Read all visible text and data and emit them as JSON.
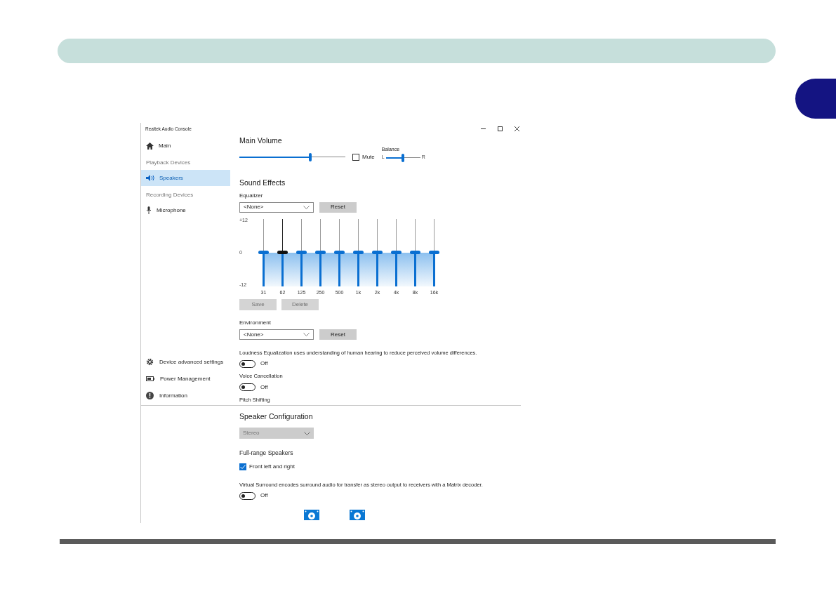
{
  "window": {
    "title": "Realtek Audio Console"
  },
  "sidebar": {
    "items": [
      {
        "kind": "item",
        "label": "Main",
        "selected": false
      },
      {
        "kind": "heading",
        "label": "Playback Devices"
      },
      {
        "kind": "item",
        "label": "Speakers",
        "selected": true
      },
      {
        "kind": "heading",
        "label": "Recording Devices"
      },
      {
        "kind": "item",
        "label": "Microphone",
        "selected": false
      }
    ],
    "bottom_items": [
      {
        "label": "Device advanced settings"
      },
      {
        "label": "Power Management"
      },
      {
        "label": "Information"
      }
    ]
  },
  "main_volume": {
    "title": "Main Volume",
    "level": 0.67,
    "mute": {
      "label": "Mute",
      "checked": false
    },
    "balance": {
      "label": "Balance",
      "left": "L",
      "right": "R",
      "level": 0.5
    }
  },
  "sound_effects": {
    "title": "Sound Effects",
    "equalizer": {
      "label": "Equalizer",
      "preset": "<None>",
      "reset": "Reset",
      "scale": [
        "+12",
        "0",
        "-12"
      ],
      "bands": [
        {
          "label": "31",
          "level": 0.5,
          "selected": false
        },
        {
          "label": "62",
          "level": 0.5,
          "selected": true
        },
        {
          "label": "125",
          "level": 0.5,
          "selected": false
        },
        {
          "label": "250",
          "level": 0.5,
          "selected": false
        },
        {
          "label": "500",
          "level": 0.5,
          "selected": false
        },
        {
          "label": "1k",
          "level": 0.5,
          "selected": false
        },
        {
          "label": "2k",
          "level": 0.5,
          "selected": false
        },
        {
          "label": "4k",
          "level": 0.5,
          "selected": false
        },
        {
          "label": "8k",
          "level": 0.5,
          "selected": false
        },
        {
          "label": "16k",
          "level": 0.5,
          "selected": false
        }
      ],
      "buttons": [
        {
          "label": "Save",
          "disabled": true
        },
        {
          "label": "Delete",
          "disabled": true
        }
      ]
    },
    "environment": {
      "label": "Environment",
      "preset": "<None>",
      "reset": "Reset"
    },
    "toggles": [
      {
        "label": "Loudness Equalization uses understanding of human hearing to reduce perceived volume differences.",
        "on": false,
        "state_label": "Off"
      },
      {
        "label": "Voice Cancellation",
        "on": false,
        "state_label": "Off"
      }
    ],
    "pitch_shifting": "Pitch Shifting"
  },
  "speaker_configuration": {
    "title": "Speaker Configuration",
    "value": "Stereo",
    "disabled": true
  },
  "full_range_speakers": {
    "title": "Full-range Speakers",
    "options": [
      {
        "label": "Front left and right",
        "checked": true
      }
    ]
  },
  "virtual_surround": {
    "label": "Virtual Surround encodes surround audio for transfer as stereo output to receivers with a Matrix decoder.",
    "on": false,
    "state_label": "Off"
  }
}
